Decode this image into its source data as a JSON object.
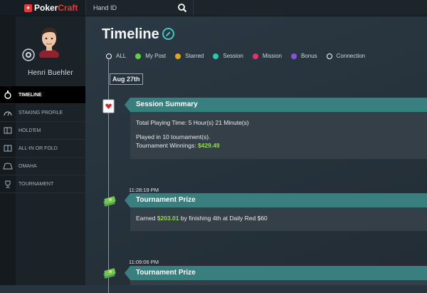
{
  "app": {
    "brand_part1": "Poker",
    "brand_part2": "Craft"
  },
  "search": {
    "placeholder": "Hand ID",
    "icon": "search-icon"
  },
  "user": {
    "name": "Henri Buehler"
  },
  "sidebar": {
    "items": [
      {
        "label": "TIMELINE",
        "icon": "stopwatch-icon",
        "active": true
      },
      {
        "label": "STAKING PROFILE",
        "icon": "gauge-icon",
        "active": false
      },
      {
        "label": "HOLD'EM",
        "icon": "cards-icon",
        "active": false
      },
      {
        "label": "ALL-IN OR FOLD",
        "icon": "all-in-cards-icon",
        "active": false
      },
      {
        "label": "OMAHA",
        "icon": "omaha-cards-icon",
        "active": false
      },
      {
        "label": "TOURNAMENT",
        "icon": "trophy-icon",
        "active": false
      }
    ]
  },
  "main": {
    "title": "Timeline",
    "filters": [
      {
        "label": "ALL",
        "color": "#ffffff",
        "hollow": true
      },
      {
        "label": "My Post",
        "color": "#5fd33b"
      },
      {
        "label": "Starred",
        "color": "#e8a21d"
      },
      {
        "label": "Session",
        "color": "#27c9b0"
      },
      {
        "label": "Mission",
        "color": "#e0356a"
      },
      {
        "label": "Bonus",
        "color": "#8a4fe3"
      },
      {
        "label": "Connection",
        "color": "#ffffff",
        "hollow": true
      }
    ],
    "date_badge": "Aug 27th",
    "events": [
      {
        "type": "session",
        "icon": "heart-card-icon",
        "title": "Session Summary",
        "line1": "Total Playing Time: 5 Hour(s) 21 Minute(s)",
        "line2": "Played in 10 tournament(s).",
        "line3_prefix": "Tournament Winnings: ",
        "line3_amount": "$429.49"
      },
      {
        "type": "prize",
        "icon": "money-stack-icon",
        "time": "11:28:19 PM",
        "title": "Tournament Prize",
        "text_prefix": "Earned ",
        "amount": "$203.01",
        "text_suffix": " by finishing 4th at Daily Red $60"
      },
      {
        "type": "prize",
        "icon": "money-stack-icon",
        "time": "11:09:06 PM",
        "title": "Tournament Prize"
      }
    ]
  }
}
